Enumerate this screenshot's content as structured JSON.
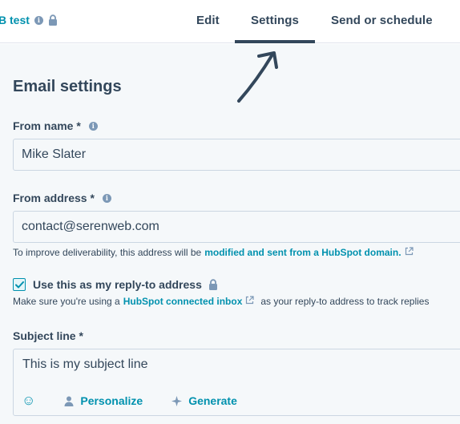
{
  "header": {
    "breadcrumb": "B test",
    "tabs": [
      {
        "label": "Edit",
        "active": false
      },
      {
        "label": "Settings",
        "active": true
      },
      {
        "label": "Send or schedule",
        "active": false
      }
    ]
  },
  "email_settings": {
    "title": "Email settings",
    "from_name": {
      "label": "From name *",
      "value": "Mike Slater"
    },
    "from_address": {
      "label": "From address *",
      "value": "contact@serenweb.com",
      "hint_prefix": "To improve deliverability, this address will be",
      "hint_link": "modified and sent from a HubSpot domain."
    },
    "reply_to": {
      "checked": true,
      "label": "Use this as my reply-to address",
      "hint_prefix": "Make sure you're using a",
      "hint_link": "HubSpot connected inbox",
      "hint_suffix": "as your reply-to address to track replies"
    },
    "subject": {
      "label": "Subject line *",
      "value": "This is my subject line",
      "personalize_label": "Personalize",
      "generate_label": "Generate"
    }
  },
  "colors": {
    "text": "#33475b",
    "link": "#0091ae",
    "border": "#cbd6e2",
    "background": "#f5f8fa"
  }
}
